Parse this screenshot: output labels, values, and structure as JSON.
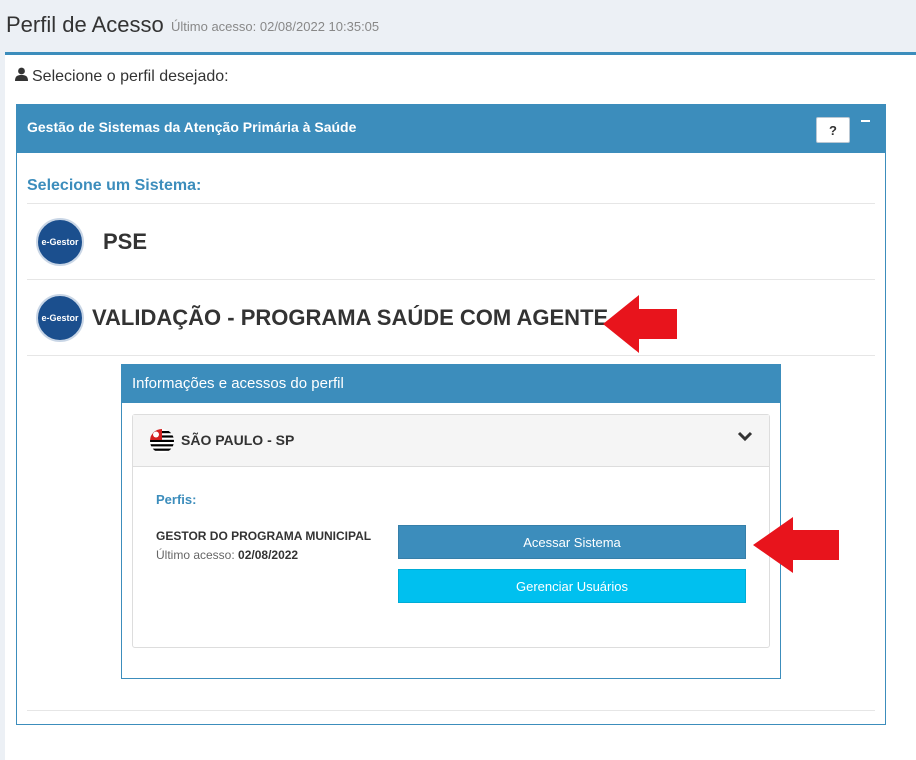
{
  "header": {
    "title": "Perfil de Acesso",
    "subtitle": "Último acesso: 02/08/2022 10:35:05"
  },
  "box": {
    "prompt": "Selecione o perfil desejado:"
  },
  "panel": {
    "title": "Gestão de Sistemas da Atenção Primária à Saúde",
    "help_label": "?",
    "select_label": "Selecione um Sistema:",
    "systems": [
      {
        "logo_text": "e-Gestor",
        "name": "PSE"
      },
      {
        "logo_text": "e-Gestor",
        "name": "VALIDAÇÃO - PROGRAMA SAÚDE COM AGENTE"
      }
    ]
  },
  "info": {
    "title": "Informações e acessos do perfil",
    "state": "SÃO PAULO - SP",
    "perfis_label": "Perfis:",
    "profile": {
      "name": "GESTOR DO PROGRAMA MUNICIPAL",
      "last_access_label": "Último acesso:",
      "last_access_date": "02/08/2022"
    },
    "access_button": "Acessar Sistema",
    "manage_button": "Gerenciar Usuários"
  },
  "colors": {
    "primary": "#3c8dbc",
    "info": "#00c0ef",
    "arrow": "#e8141c"
  },
  "icons": [
    "user-icon",
    "question-icon",
    "minus-icon",
    "chevron-down-icon",
    "flag-icon",
    "red-arrow-icon"
  ]
}
